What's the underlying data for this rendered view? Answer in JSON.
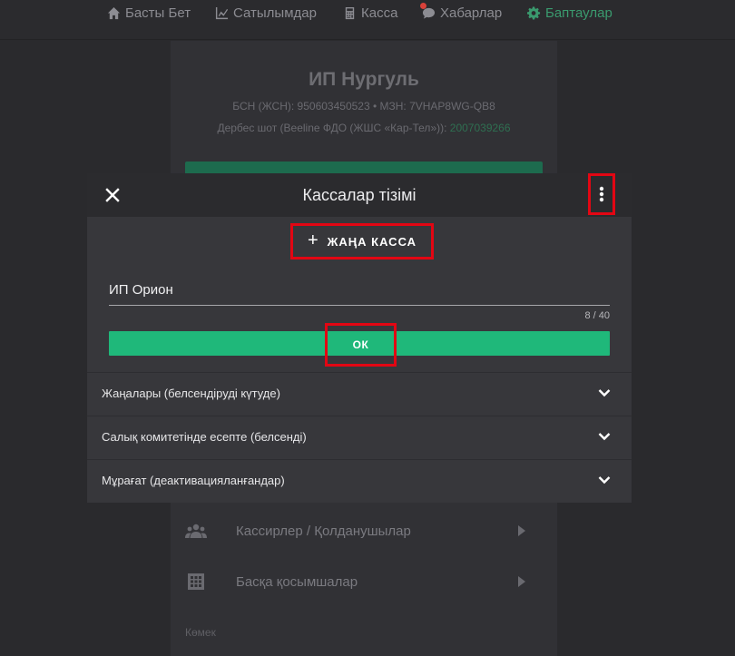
{
  "nav": {
    "items": [
      {
        "label": "Басты Бет",
        "icon": "home-icon"
      },
      {
        "label": "Сатылымдар",
        "icon": "chart-icon"
      },
      {
        "label": "Касса",
        "icon": "calculator-icon"
      },
      {
        "label": "Хабарлар",
        "icon": "chat-icon"
      },
      {
        "label": "Баптаулар",
        "icon": "gear-icon"
      }
    ],
    "active_color": "#3a9a6e"
  },
  "shop": {
    "name": "ИП Нургуль",
    "ids_line": "БСН (ЖСН): 950603450523 • МЗН: 7VHAP8WG-QB8",
    "account_label": "Дербес шот (Beeline ФДО (ЖШС «Кар-Тел»)):",
    "account_number": "2007039266"
  },
  "background_menu": {
    "items": [
      {
        "label": "Кассирлер / Қолданушылар",
        "icon": "users-icon"
      },
      {
        "label": "Басқа қосымшалар",
        "icon": "apps-grid-icon"
      }
    ],
    "help_label": "Көмек"
  },
  "dialog": {
    "title": "Кассалар тізімі",
    "new_button_label": "ЖАҢА КАССА",
    "input_value": "ИП Орион",
    "counter": "8 / 40",
    "ok_label": "ОК",
    "accent_color": "#1fb87a",
    "highlight_color": "#e30613",
    "sections": [
      {
        "label": "Жаңалары (белсендіруді күтуде)"
      },
      {
        "label": "Салық комитетінде есепте (белсенді)"
      },
      {
        "label": "Мұрағат (деактивацияланғандар)"
      }
    ]
  }
}
